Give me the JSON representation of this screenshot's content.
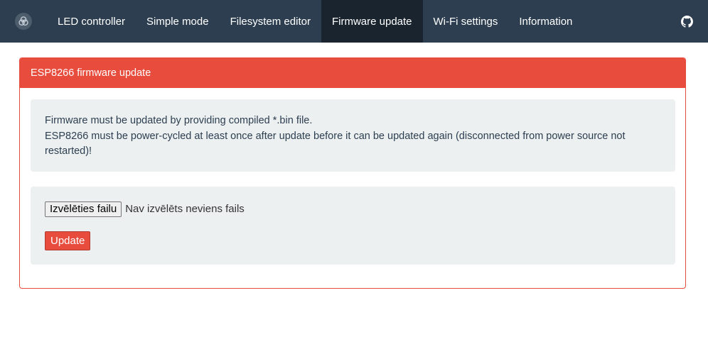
{
  "nav": {
    "logo_icon": "app-logo-icon",
    "items": [
      {
        "label": "LED controller"
      },
      {
        "label": "Simple mode"
      },
      {
        "label": "Filesystem editor"
      },
      {
        "label": "Firmware update",
        "active": true
      },
      {
        "label": "Wi-Fi settings"
      },
      {
        "label": "Information"
      }
    ],
    "github_icon": "github-icon"
  },
  "panel": {
    "title": "ESP8266 firmware update",
    "info_line1": "Firmware must be updated by providing compiled *.bin file.",
    "info_line2": "ESP8266 must be power-cycled at least once after update before it can be updated again (disconnected from power source not restarted)!"
  },
  "form": {
    "file_button_label": "Izvēlēties failu",
    "file_status": "Nav izvēlēts neviens fails",
    "update_label": "Update"
  },
  "colors": {
    "navbar": "#2c3e50",
    "navbar_active": "#1a242f",
    "danger": "#e74c3c",
    "well": "#ecf0f1",
    "text": "#2c3e50"
  }
}
